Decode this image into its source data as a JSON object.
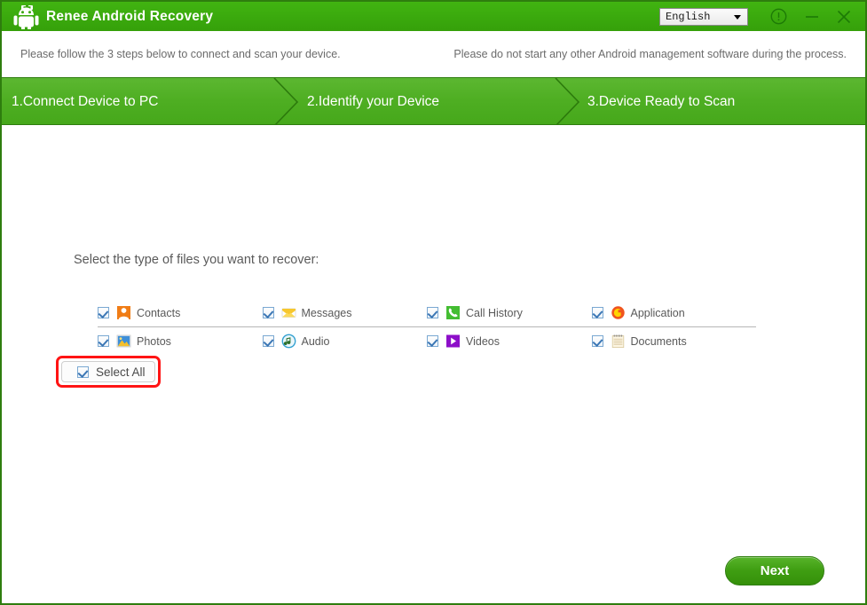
{
  "window": {
    "title": "Renee Android Recovery",
    "logo_icon": "android-doctor-icon",
    "language": {
      "selected": "English",
      "caret_icon": "chevron-down-icon"
    },
    "controls": {
      "info_icon": "info-circle-icon",
      "minimize_icon": "minimize-icon",
      "close_icon": "close-icon"
    },
    "colors": {
      "title_green": "#3aa80d",
      "step_green": "#4eae22",
      "border_green": "#2e7d0e",
      "highlight_red": "#ff1414"
    }
  },
  "notice": {
    "left": "Please follow the 3 steps below to connect and scan your device.",
    "right": "Please do not start any other Android management software during the process."
  },
  "steps": [
    {
      "label": "1.Connect Device to PC"
    },
    {
      "label": "2.Identify your Device"
    },
    {
      "label": "3.Device Ready to Scan"
    }
  ],
  "main": {
    "prompt": "Select the type of files you want to recover:",
    "file_types": [
      [
        {
          "label": "Contacts",
          "icon": "contacts-icon",
          "checked": true
        },
        {
          "label": "Messages",
          "icon": "messages-icon",
          "checked": true
        },
        {
          "label": "Call History",
          "icon": "call-history-icon",
          "checked": true
        },
        {
          "label": "Application",
          "icon": "application-icon",
          "checked": true
        }
      ],
      [
        {
          "label": "Photos",
          "icon": "photos-icon",
          "checked": true
        },
        {
          "label": "Audio",
          "icon": "audio-icon",
          "checked": true
        },
        {
          "label": "Videos",
          "icon": "videos-icon",
          "checked": true
        },
        {
          "label": "Documents",
          "icon": "documents-icon",
          "checked": true
        }
      ]
    ],
    "select_all": {
      "label": "Select All",
      "checked": true
    },
    "next_button": {
      "label": "Next"
    }
  }
}
